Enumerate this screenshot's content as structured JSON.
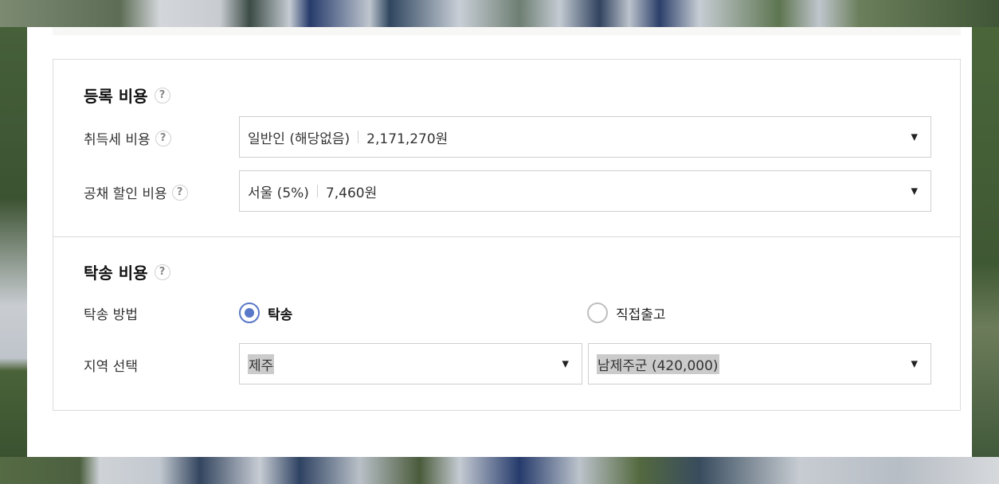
{
  "registration": {
    "title": "등록 비용",
    "acquisition_tax": {
      "label": "취득세 비용",
      "selected": "일반인 (해당없음)",
      "amount": "2,171,270원"
    },
    "bond_discount": {
      "label": "공채 할인 비용",
      "selected": "서울 (5%)",
      "amount": "7,460원"
    }
  },
  "shipping": {
    "title": "탁송 비용",
    "method": {
      "label": "탁송 방법",
      "options": [
        "탁송",
        "직접출고"
      ],
      "selected": "탁송"
    },
    "region": {
      "label": "지역 선택",
      "region_value": "제주",
      "district_value": "남제주군 (420,000)"
    }
  },
  "icons": {
    "help": "?",
    "dropdown": "▼"
  }
}
